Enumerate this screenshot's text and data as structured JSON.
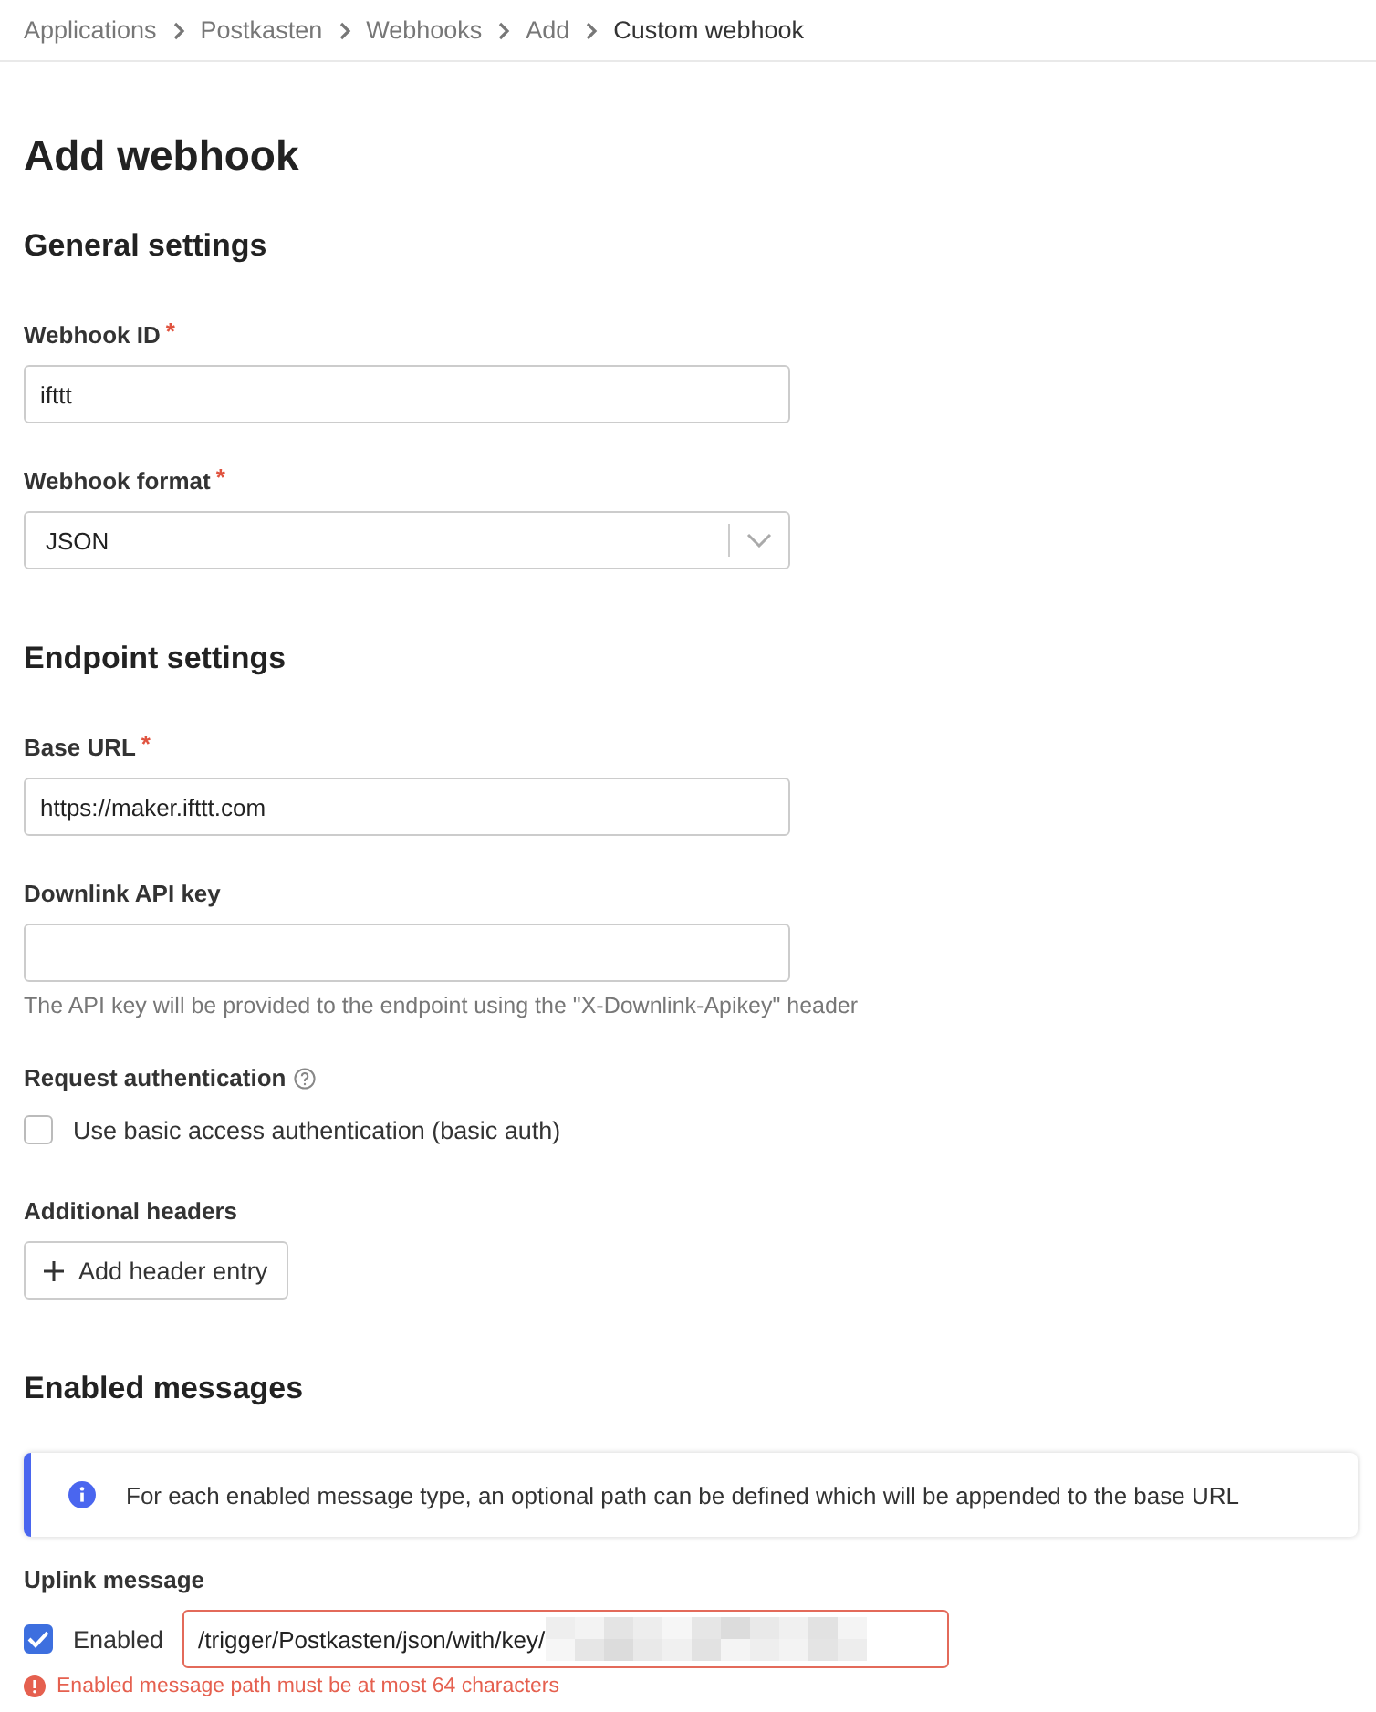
{
  "breadcrumb": [
    {
      "label": "Applications",
      "current": false
    },
    {
      "label": "Postkasten",
      "current": false
    },
    {
      "label": "Webhooks",
      "current": false
    },
    {
      "label": "Add",
      "current": false
    },
    {
      "label": "Custom webhook",
      "current": true
    }
  ],
  "title": "Add webhook",
  "sections": [
    {
      "heading": "General settings",
      "fields": [
        {
          "kind": "text",
          "label": "Webhook ID",
          "required_mark": "*",
          "value": "ifttt"
        },
        {
          "kind": "select",
          "label": "Webhook format",
          "required_mark": "*",
          "value": "JSON"
        }
      ]
    },
    {
      "heading": "Endpoint settings",
      "fields": [
        {
          "kind": "text",
          "label": "Base URL",
          "required_mark": "*",
          "value": "https://maker.ifttt.com"
        },
        {
          "kind": "text",
          "label": "Downlink API key",
          "description": "The API key will be provided to the endpoint using the \"X-Downlink-Apikey\" header"
        },
        {
          "kind": "checkbox",
          "label": "Request authentication",
          "help": true,
          "option": "Use basic access authentication (basic auth)",
          "checked": false
        },
        {
          "kind": "button",
          "label": "Additional headers",
          "button": "Add header entry"
        }
      ]
    },
    {
      "heading": "Enabled messages",
      "notice": "For each enabled message type, an optional path can be defined which will be appended to the base URL",
      "fields": [
        {
          "kind": "message",
          "label": "Uplink message",
          "option": "Enabled",
          "checked": true,
          "value": "/trigger/Postkasten/json/with/key/",
          "redacted": true,
          "error": "Enabled message path must be at most 64 characters"
        }
      ]
    }
  ]
}
